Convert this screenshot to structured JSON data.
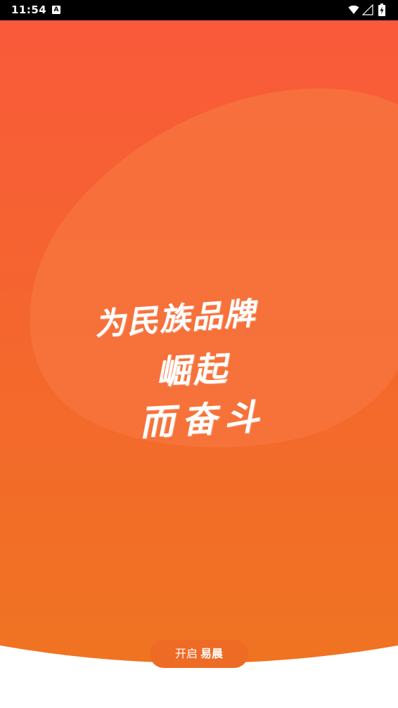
{
  "status_bar": {
    "time": "11:54",
    "notification_icon": "A",
    "icons": [
      "wifi-icon",
      "signal-icon",
      "battery-charging-icon"
    ]
  },
  "splash": {
    "slogan_lines": [
      "为民族品牌",
      "崛起",
      "而奋斗"
    ],
    "colors": {
      "gradient_top": "#f95a3a",
      "gradient_bottom": "#ef7520",
      "blob": "#f7763f",
      "button_bg": "#ee6b25",
      "bottom_white": "#ffffff"
    }
  },
  "start_button": {
    "label_prefix": "开启",
    "brand": "易晨"
  }
}
